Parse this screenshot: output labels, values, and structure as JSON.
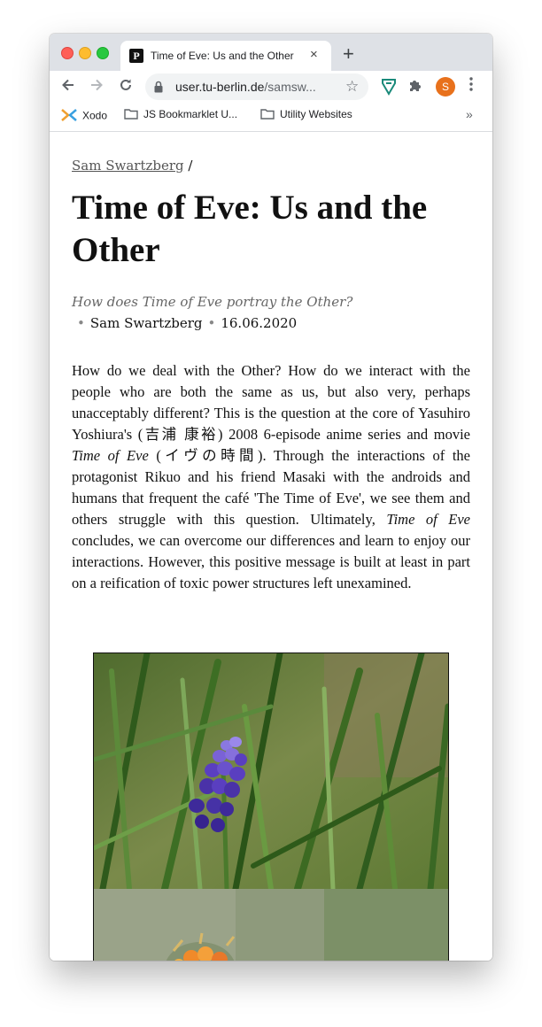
{
  "browser": {
    "tab_title": "Time of Eve: Us and the Other",
    "tab_favicon": "P",
    "close_glyph": "×",
    "newtab_glyph": "+",
    "url_host": "user.tu-berlin.de",
    "url_path": "/samsw...",
    "avatar_letter": "S",
    "bookmarks": [
      {
        "label": "Xodo",
        "icon": "xodo-icon"
      },
      {
        "label": "JS Bookmarklet U...",
        "icon": "folder-icon"
      },
      {
        "label": "Utility Websites",
        "icon": "folder-icon"
      }
    ],
    "bookmarks_overflow": "»"
  },
  "article": {
    "breadcrumb_author": "Sam Swartzberg",
    "breadcrumb_sep": "/",
    "title": "Time of Eve: Us and the Other",
    "subtitle": "How does Time of Eve portray the Other?",
    "author": "Sam Swartzberg",
    "date": "16.06.2020",
    "body_p1": "How do we deal with the Other? How do we interact with the people who are both the same as us, but also very, perhaps unacceptably different? This is the question at the core of Yasuhiro Yoshiura's (吉浦 康裕) 2008 6-episode anime series and movie ",
    "body_em1": "Time of Eve",
    "body_p2": " (イヴの時間). Through the interactions of the protagonist Rikuo and his friend Masaki with the androids and humans that frequent the café 'The Time of Eve', we see them and others struggle with this question. Ultimately, ",
    "body_em2": "Time of Eve",
    "body_p3": " concludes, we can overcome our differences and learn to enjoy our interactions. However, this positive message is built at least in part on a reification of toxic power structures left unexamined."
  },
  "colors": {
    "tabstrip": "#dee1e6",
    "avatar": "#e8711c",
    "flower": "#5a3fc0"
  }
}
